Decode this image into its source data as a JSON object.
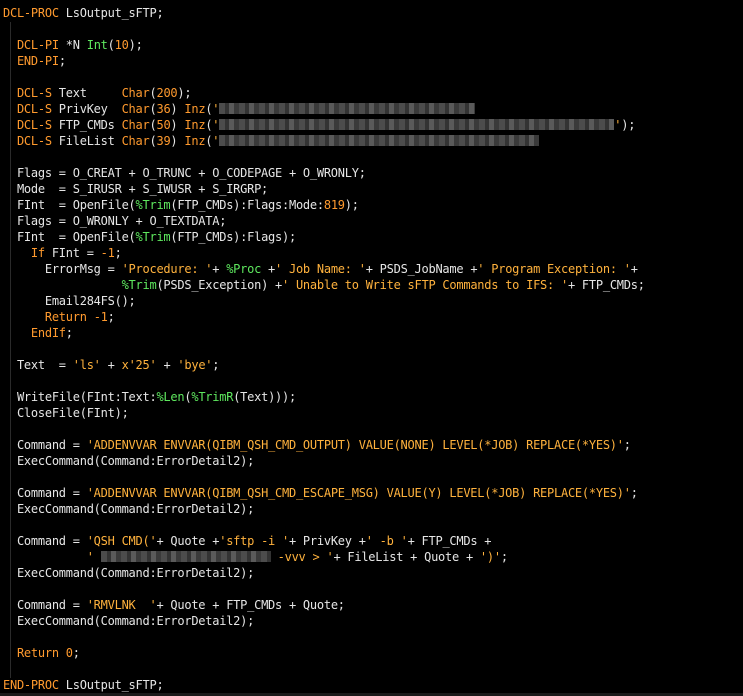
{
  "lines": [
    {
      "segs": [
        {
          "c": "kw",
          "t": "DCL-PROC"
        },
        {
          "c": "pl",
          "t": " LsOutput_sFTP;"
        }
      ]
    },
    {
      "segs": []
    },
    {
      "segs": [
        {
          "c": "pl",
          "t": "  "
        },
        {
          "c": "kw",
          "t": "DCL-PI"
        },
        {
          "c": "pl",
          "t": " *N "
        },
        {
          "c": "fn",
          "t": "Int"
        },
        {
          "c": "pl",
          "t": "("
        },
        {
          "c": "num",
          "t": "10"
        },
        {
          "c": "pl",
          "t": ");"
        }
      ]
    },
    {
      "segs": [
        {
          "c": "pl",
          "t": "  "
        },
        {
          "c": "kw",
          "t": "END-PI"
        },
        {
          "c": "pl",
          "t": ";"
        }
      ]
    },
    {
      "segs": []
    },
    {
      "segs": [
        {
          "c": "pl",
          "t": "  "
        },
        {
          "c": "kw",
          "t": "DCL-S"
        },
        {
          "c": "pl",
          "t": " Text     "
        },
        {
          "c": "kw",
          "t": "Char"
        },
        {
          "c": "pl",
          "t": "("
        },
        {
          "c": "num",
          "t": "200"
        },
        {
          "c": "pl",
          "t": ");"
        }
      ]
    },
    {
      "segs": [
        {
          "c": "pl",
          "t": "  "
        },
        {
          "c": "kw",
          "t": "DCL-S"
        },
        {
          "c": "pl",
          "t": " PrivKey  "
        },
        {
          "c": "kw",
          "t": "Char"
        },
        {
          "c": "pl",
          "t": "("
        },
        {
          "c": "num",
          "t": "36"
        },
        {
          "c": "pl",
          "t": ") "
        },
        {
          "c": "kw",
          "t": "Inz"
        },
        {
          "c": "pl",
          "t": "("
        },
        {
          "c": "str",
          "t": "'"
        },
        {
          "c": "blur",
          "w": 256
        }
      ]
    },
    {
      "segs": [
        {
          "c": "pl",
          "t": "  "
        },
        {
          "c": "kw",
          "t": "DCL-S"
        },
        {
          "c": "pl",
          "t": " FTP_CMDs "
        },
        {
          "c": "kw",
          "t": "Char"
        },
        {
          "c": "pl",
          "t": "("
        },
        {
          "c": "num",
          "t": "50"
        },
        {
          "c": "pl",
          "t": ") "
        },
        {
          "c": "kw",
          "t": "Inz"
        },
        {
          "c": "pl",
          "t": "("
        },
        {
          "c": "str",
          "t": "'"
        },
        {
          "c": "blur",
          "w": 395
        },
        {
          "c": "str",
          "t": "'"
        },
        {
          "c": "pl",
          "t": ");"
        }
      ]
    },
    {
      "segs": [
        {
          "c": "pl",
          "t": "  "
        },
        {
          "c": "kw",
          "t": "DCL-S"
        },
        {
          "c": "pl",
          "t": " FileList "
        },
        {
          "c": "kw",
          "t": "Char"
        },
        {
          "c": "pl",
          "t": "("
        },
        {
          "c": "num",
          "t": "39"
        },
        {
          "c": "pl",
          "t": ") "
        },
        {
          "c": "kw",
          "t": "Inz"
        },
        {
          "c": "pl",
          "t": "("
        },
        {
          "c": "str",
          "t": "'"
        },
        {
          "c": "blur",
          "w": 320
        }
      ]
    },
    {
      "segs": []
    },
    {
      "segs": [
        {
          "c": "pl",
          "t": "  Flags = O_CREAT + O_TRUNC + O_CODEPAGE + O_WRONLY;"
        }
      ]
    },
    {
      "segs": [
        {
          "c": "pl",
          "t": "  Mode  = S_IRUSR + S_IWUSR + S_IRGRP;"
        }
      ]
    },
    {
      "segs": [
        {
          "c": "pl",
          "t": "  FInt  = OpenFile("
        },
        {
          "c": "fn",
          "t": "%Trim"
        },
        {
          "c": "pl",
          "t": "(FTP_CMDs):Flags:Mode:"
        },
        {
          "c": "num",
          "t": "819"
        },
        {
          "c": "pl",
          "t": ");"
        }
      ]
    },
    {
      "segs": [
        {
          "c": "pl",
          "t": "  Flags = O_WRONLY + O_TEXTDATA;"
        }
      ]
    },
    {
      "segs": [
        {
          "c": "pl",
          "t": "  FInt  = OpenFile("
        },
        {
          "c": "fn",
          "t": "%Trim"
        },
        {
          "c": "pl",
          "t": "(FTP_CMDs):Flags);"
        }
      ]
    },
    {
      "segs": [
        {
          "c": "pl",
          "t": "    "
        },
        {
          "c": "kw",
          "t": "If"
        },
        {
          "c": "pl",
          "t": " FInt = "
        },
        {
          "c": "num",
          "t": "-1"
        },
        {
          "c": "pl",
          "t": ";"
        }
      ]
    },
    {
      "segs": [
        {
          "c": "pl",
          "t": "      ErrorMsg = "
        },
        {
          "c": "str",
          "t": "'Procedure: '"
        },
        {
          "c": "pl",
          "t": "+ "
        },
        {
          "c": "fn",
          "t": "%Proc"
        },
        {
          "c": "pl",
          "t": " +"
        },
        {
          "c": "str",
          "t": "' Job Name: '"
        },
        {
          "c": "pl",
          "t": "+ PSDS_JobName +"
        },
        {
          "c": "str",
          "t": "' Program Exception: '"
        },
        {
          "c": "pl",
          "t": "+"
        }
      ]
    },
    {
      "segs": [
        {
          "c": "pl",
          "t": "                 "
        },
        {
          "c": "fn",
          "t": "%Trim"
        },
        {
          "c": "pl",
          "t": "(PSDS_Exception) +"
        },
        {
          "c": "str",
          "t": "' Unable to Write sFTP Commands to IFS: '"
        },
        {
          "c": "pl",
          "t": "+ FTP_CMDs;"
        }
      ]
    },
    {
      "segs": [
        {
          "c": "pl",
          "t": "      Email284FS();"
        }
      ]
    },
    {
      "segs": [
        {
          "c": "pl",
          "t": "      "
        },
        {
          "c": "kw",
          "t": "Return"
        },
        {
          "c": "pl",
          "t": " "
        },
        {
          "c": "num",
          "t": "-1"
        },
        {
          "c": "pl",
          "t": ";"
        }
      ]
    },
    {
      "segs": [
        {
          "c": "pl",
          "t": "    "
        },
        {
          "c": "kw",
          "t": "EndIf"
        },
        {
          "c": "pl",
          "t": ";"
        }
      ]
    },
    {
      "segs": []
    },
    {
      "segs": [
        {
          "c": "pl",
          "t": "  Text  = "
        },
        {
          "c": "str",
          "t": "'ls'"
        },
        {
          "c": "pl",
          "t": " + "
        },
        {
          "c": "str",
          "t": "x'25'"
        },
        {
          "c": "pl",
          "t": " + "
        },
        {
          "c": "str",
          "t": "'bye'"
        },
        {
          "c": "pl",
          "t": ";"
        }
      ]
    },
    {
      "segs": []
    },
    {
      "segs": [
        {
          "c": "pl",
          "t": "  WriteFile(FInt:Text:"
        },
        {
          "c": "fn",
          "t": "%Len"
        },
        {
          "c": "pl",
          "t": "("
        },
        {
          "c": "fn",
          "t": "%TrimR"
        },
        {
          "c": "pl",
          "t": "(Text)));"
        }
      ]
    },
    {
      "segs": [
        {
          "c": "pl",
          "t": "  CloseFile(FInt);"
        }
      ]
    },
    {
      "segs": []
    },
    {
      "segs": [
        {
          "c": "pl",
          "t": "  Command = "
        },
        {
          "c": "str",
          "t": "'ADDENVVAR ENVVAR(QIBM_QSH_CMD_OUTPUT) VALUE(NONE) LEVEL(*JOB) REPLACE(*YES)'"
        },
        {
          "c": "pl",
          "t": ";"
        }
      ]
    },
    {
      "segs": [
        {
          "c": "pl",
          "t": "  ExecCommand(Command:ErrorDetail2);"
        }
      ]
    },
    {
      "segs": []
    },
    {
      "segs": [
        {
          "c": "pl",
          "t": "  Command = "
        },
        {
          "c": "str",
          "t": "'ADDENVVAR ENVVAR(QIBM_QSH_CMD_ESCAPE_MSG) VALUE(Y) LEVEL(*JOB) REPLACE(*YES)'"
        },
        {
          "c": "pl",
          "t": ";"
        }
      ]
    },
    {
      "segs": [
        {
          "c": "pl",
          "t": "  ExecCommand(Command:ErrorDetail2);"
        }
      ]
    },
    {
      "segs": []
    },
    {
      "segs": [
        {
          "c": "pl",
          "t": "  Command = "
        },
        {
          "c": "str",
          "t": "'QSH CMD('"
        },
        {
          "c": "pl",
          "t": "+ Quote +"
        },
        {
          "c": "str",
          "t": "'sftp -i '"
        },
        {
          "c": "pl",
          "t": "+ PrivKey +"
        },
        {
          "c": "str",
          "t": "' -b '"
        },
        {
          "c": "pl",
          "t": "+ FTP_CMDs +"
        }
      ]
    },
    {
      "segs": [
        {
          "c": "pl",
          "t": "            "
        },
        {
          "c": "str",
          "t": "' "
        },
        {
          "c": "blur",
          "w": 170
        },
        {
          "c": "str",
          "t": " -vvv > '"
        },
        {
          "c": "pl",
          "t": "+ FileList + Quote + "
        },
        {
          "c": "str",
          "t": "')'"
        },
        {
          "c": "pl",
          "t": ";"
        }
      ]
    },
    {
      "segs": [
        {
          "c": "pl",
          "t": "  ExecCommand(Command:ErrorDetail2);"
        }
      ]
    },
    {
      "segs": []
    },
    {
      "segs": [
        {
          "c": "pl",
          "t": "  Command = "
        },
        {
          "c": "str",
          "t": "'RMVLNK  '"
        },
        {
          "c": "pl",
          "t": "+ Quote + FTP_CMDs + Quote;"
        }
      ]
    },
    {
      "segs": [
        {
          "c": "pl",
          "t": "  ExecCommand(Command:ErrorDetail2);"
        }
      ]
    },
    {
      "segs": []
    },
    {
      "segs": [
        {
          "c": "pl",
          "t": "  "
        },
        {
          "c": "kw",
          "t": "Return"
        },
        {
          "c": "pl",
          "t": " "
        },
        {
          "c": "num",
          "t": "0"
        },
        {
          "c": "pl",
          "t": ";"
        }
      ]
    },
    {
      "segs": []
    },
    {
      "segs": [
        {
          "c": "kw",
          "t": "END-PROC"
        },
        {
          "c": "pl",
          "t": " LsOutput_sFTP;"
        }
      ]
    }
  ]
}
